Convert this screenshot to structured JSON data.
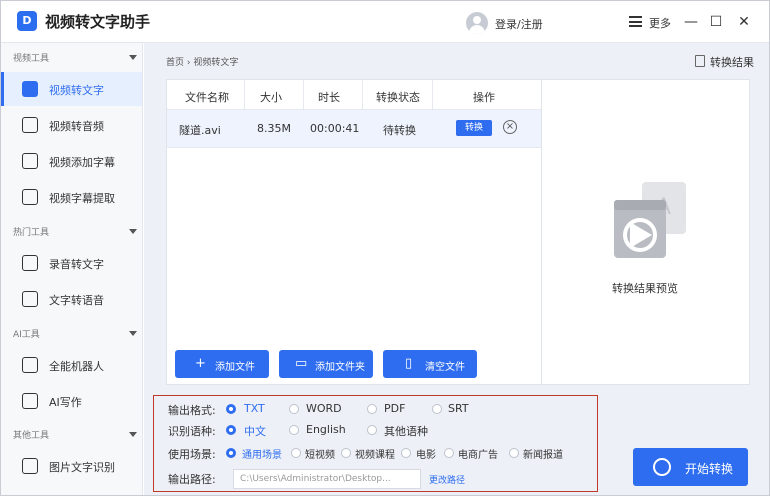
{
  "window": {
    "app_title": "视频转文字助手",
    "login_label": "登录/注册",
    "more_label": "更多",
    "minimize_glyph": "—",
    "maximize_glyph": "☐",
    "close_glyph": "✕"
  },
  "sidebar": {
    "groups": [
      {
        "label": "视频工具"
      },
      {
        "label": "热门工具"
      },
      {
        "label": "AI工具"
      },
      {
        "label": "其他工具"
      }
    ],
    "items": [
      {
        "label": "视频转文字",
        "active": true,
        "icon": "video-to-text-icon"
      },
      {
        "label": "视频转音频",
        "active": false,
        "icon": "video-to-audio-icon"
      },
      {
        "label": "视频添加字幕",
        "active": false,
        "icon": "add-subtitle-icon"
      },
      {
        "label": "视频字幕提取",
        "active": false,
        "icon": "subtitle-extract-icon"
      },
      {
        "label": "录音转文字",
        "active": false,
        "icon": "recording-icon"
      },
      {
        "label": "文字转语音",
        "active": false,
        "icon": "text-to-speech-icon"
      },
      {
        "label": "全能机器人",
        "active": false,
        "icon": "robot-icon"
      },
      {
        "label": "AI写作",
        "active": false,
        "icon": "ai-writing-icon"
      },
      {
        "label": "图片文字识别",
        "active": false,
        "icon": "image-ocr-icon"
      }
    ]
  },
  "main": {
    "breadcrumb": "首页 › 视频转文字",
    "results_link": "转换结果",
    "table": {
      "headers": [
        "文件名称",
        "大小",
        "时长",
        "转换状态",
        "操作"
      ],
      "rows": [
        {
          "name": "隧道.avi",
          "size": "8.35M",
          "duration": "00:00:41",
          "status": "待转换",
          "action_label": "转换"
        }
      ]
    },
    "buttons": {
      "add_file": "添加文件",
      "add_folder": "添加文件夹",
      "clear_files": "清空文件"
    },
    "preview_label": "转换结果预览"
  },
  "options": {
    "output_format": {
      "label": "输出格式:",
      "choices": [
        "TXT",
        "WORD",
        "PDF",
        "SRT"
      ],
      "selected": "TXT"
    },
    "language": {
      "label": "识别语种:",
      "choices": [
        "中文",
        "English",
        "其他语种"
      ],
      "selected": "中文"
    },
    "scene": {
      "label": "使用场景:",
      "choices": [
        "通用场景",
        "短视频",
        "视频课程",
        "电影",
        "电商广告",
        "新闻报道"
      ],
      "selected": "通用场景"
    },
    "output_path": {
      "label": "输出路径:",
      "value": "C:\\Users\\Administrator\\Desktop...",
      "change_label": "更改路径"
    }
  },
  "start_button": "开始转换",
  "colors": {
    "accent": "#2f6df0",
    "options_border": "#c0392b",
    "main_bg": "#edf1f7",
    "active_bg": "#e6effd"
  }
}
